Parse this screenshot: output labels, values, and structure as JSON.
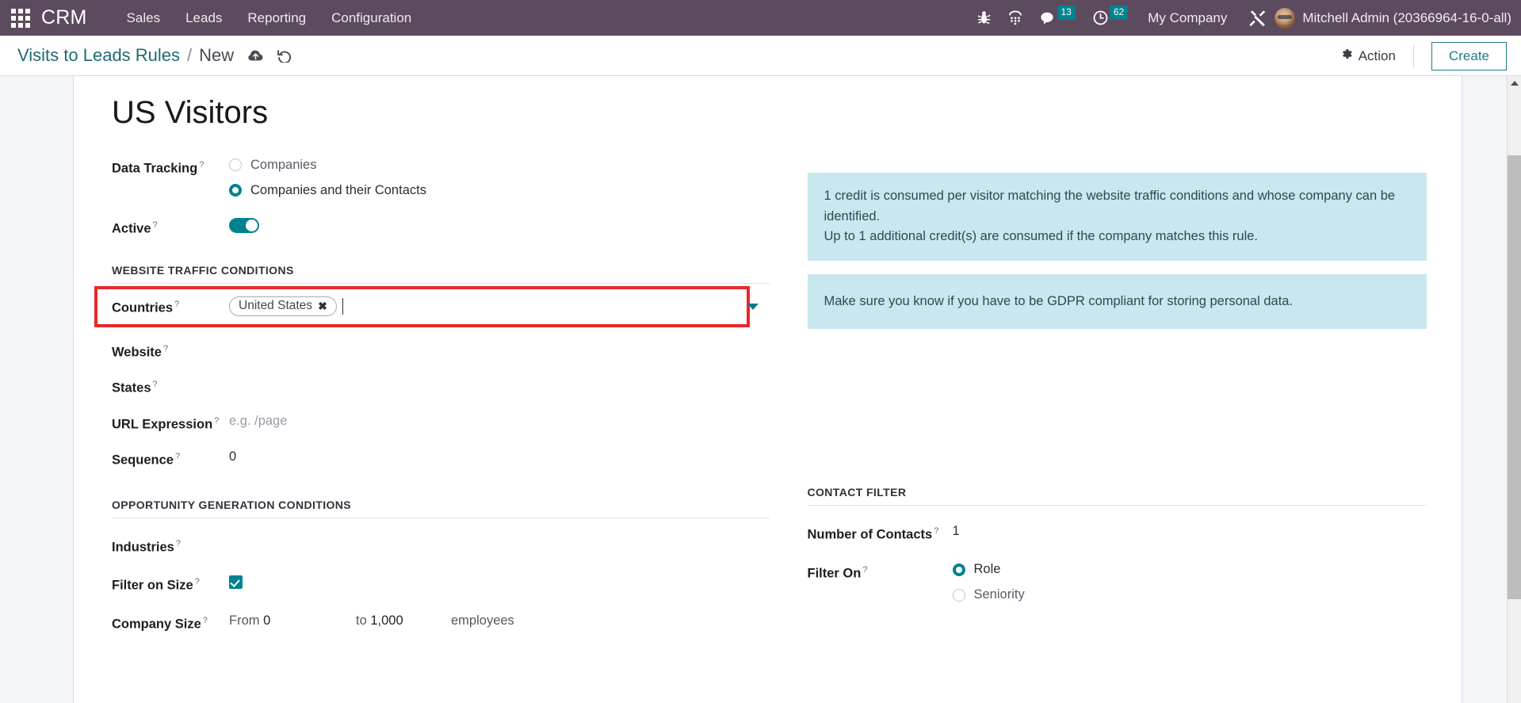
{
  "navbar": {
    "apps_icon": "apps-grid-icon",
    "brand": "CRM",
    "menu": [
      {
        "label": "Sales"
      },
      {
        "label": "Leads"
      },
      {
        "label": "Reporting"
      },
      {
        "label": "Configuration"
      }
    ],
    "icons": [
      {
        "name": "bug-icon"
      },
      {
        "name": "dialpad-icon"
      }
    ],
    "messages": {
      "icon": "chat-bubble-icon",
      "count": "13"
    },
    "activities": {
      "icon": "clock-icon",
      "count": "62"
    },
    "company": "My Company",
    "tools_icon": "wrench-screwdriver-icon",
    "avatar": "user-avatar",
    "user": "Mitchell Admin (20366964-16-0-all)"
  },
  "control_panel": {
    "breadcrumb_parent": "Visits to Leads Rules",
    "breadcrumb_separator": "/",
    "breadcrumb_current": "New",
    "save_icon": "cloud-upload-icon",
    "discard_icon": "undo-icon",
    "action_icon": "gear-icon",
    "action_label": "Action",
    "create_label": "Create"
  },
  "form": {
    "title": "US Visitors",
    "data_tracking": {
      "label": "Data Tracking",
      "help": "?",
      "options": [
        {
          "label": "Companies",
          "checked": false
        },
        {
          "label": "Companies and their Contacts",
          "checked": true
        }
      ]
    },
    "active": {
      "label": "Active",
      "help": "?",
      "value": "on"
    },
    "website_traffic": {
      "heading": "Website Traffic Conditions",
      "countries": {
        "label": "Countries",
        "help": "?",
        "tags": [
          {
            "label": "United States",
            "remove": "✖"
          }
        ],
        "caret": "chevron-down-icon",
        "highlighted": "true"
      },
      "website": {
        "label": "Website",
        "help": "?",
        "value": ""
      },
      "states": {
        "label": "States",
        "help": "?",
        "value": ""
      },
      "url_expression": {
        "label": "URL Expression",
        "help": "?",
        "value": "",
        "placeholder": "e.g. /page"
      },
      "sequence": {
        "label": "Sequence",
        "help": "?",
        "value": "0"
      }
    },
    "opportunity_generation": {
      "heading": "Opportunity Generation Conditions",
      "industries": {
        "label": "Industries",
        "help": "?",
        "value": ""
      },
      "filter_on_size": {
        "label": "Filter on Size",
        "help": "?",
        "checked": true
      },
      "company_size": {
        "label": "Company Size",
        "help": "?",
        "from_prefix": "From",
        "from_value": "0",
        "to_prefix": "to",
        "to_value": "1,000",
        "suffix": "employees"
      }
    },
    "contact_filter": {
      "heading": "Contact Filter",
      "number_of_contacts": {
        "label": "Number of Contacts",
        "help": "?",
        "value": "1"
      },
      "filter_on": {
        "label": "Filter On",
        "help": "?",
        "options": [
          {
            "label": "Role",
            "checked": true
          },
          {
            "label": "Seniority",
            "checked": false
          }
        ]
      }
    },
    "alerts": [
      {
        "text": "1 credit is consumed per visitor matching the website traffic conditions and whose company can be identified.\nUp to 1 additional credit(s) are consumed if the company matches this rule."
      },
      {
        "text": "Make sure you know if you have to be GDPR compliant for storing personal data."
      }
    ]
  },
  "scrollbar": {
    "up_arrow": "scroll-up-arrow"
  },
  "colors": {
    "navbar": "#5c4a5e",
    "accent_teal": "#00828f",
    "link_teal": "#1f6b74",
    "alert_bg": "#c9e7ee",
    "highlight_red": "#e8282b",
    "page_bg": "#f4f5f8"
  }
}
